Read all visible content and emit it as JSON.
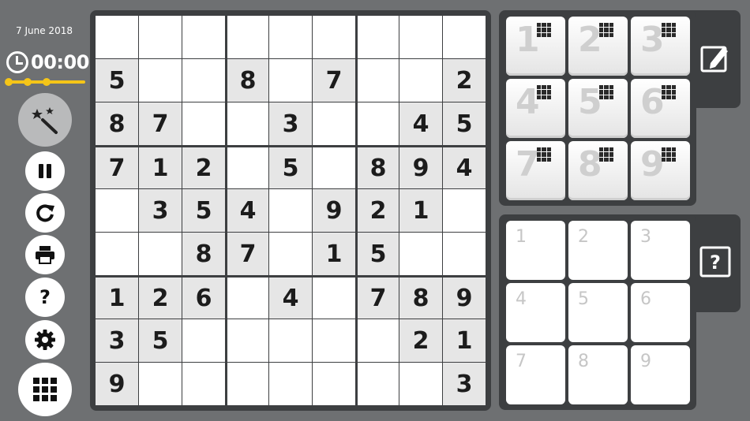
{
  "header": {
    "date": "7 June 2018",
    "timer": "00:00"
  },
  "progress": {
    "checkpoints": 3
  },
  "sidebar": {
    "buttons": [
      {
        "name": "magic-hint",
        "icon": "magic-wand-icon"
      },
      {
        "name": "pause",
        "icon": "pause-icon"
      },
      {
        "name": "restart",
        "icon": "refresh-icon"
      },
      {
        "name": "print",
        "icon": "printer-icon"
      },
      {
        "name": "help",
        "icon": "question-icon"
      },
      {
        "name": "settings",
        "icon": "gear-icon"
      },
      {
        "name": "menu",
        "icon": "grid-menu-icon"
      }
    ]
  },
  "board": {
    "rows": [
      [
        "",
        "",
        "",
        "",
        "",
        "",
        "",
        "",
        ""
      ],
      [
        "5",
        "",
        "",
        "8",
        "",
        "7",
        "",
        "",
        "2"
      ],
      [
        "8",
        "7",
        "",
        "",
        "3",
        "",
        "",
        "4",
        "5"
      ],
      [
        "7",
        "1",
        "2",
        "",
        "5",
        "",
        "8",
        "9",
        "4"
      ],
      [
        "",
        "3",
        "5",
        "4",
        "",
        "9",
        "2",
        "1",
        ""
      ],
      [
        "",
        "",
        "8",
        "7",
        "",
        "1",
        "5",
        "",
        ""
      ],
      [
        "1",
        "2",
        "6",
        "",
        "4",
        "",
        "7",
        "8",
        "9"
      ],
      [
        "3",
        "5",
        "",
        "",
        "",
        "",
        "",
        "2",
        "1"
      ],
      [
        "9",
        "",
        "",
        "",
        "",
        "",
        "",
        "",
        "3"
      ]
    ]
  },
  "number_pad": {
    "keys": [
      "1",
      "2",
      "3",
      "4",
      "5",
      "6",
      "7",
      "8",
      "9"
    ],
    "mode_icon": "pencil-edit-icon"
  },
  "notes_pad": {
    "keys": [
      "1",
      "2",
      "3",
      "4",
      "5",
      "6",
      "7",
      "8",
      "9"
    ],
    "mode_icon": "question-box-icon"
  }
}
